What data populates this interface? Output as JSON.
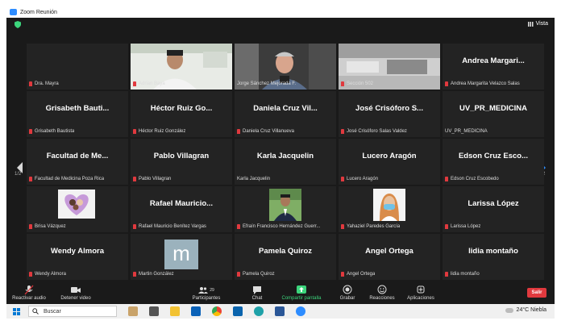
{
  "window": {
    "title": "Zoom Reunión"
  },
  "topbar": {
    "view_label": "Vista"
  },
  "pagination": {
    "left": "1/2",
    "right": "1/2"
  },
  "tiles": [
    {
      "big": "",
      "label": "Dra. Mayra",
      "muted": true,
      "video": "blank"
    },
    {
      "big": "",
      "label": "Adrian Baya",
      "muted": true,
      "video": "man-office"
    },
    {
      "big": "",
      "label": "Jorge Sánchez Mejorada F.",
      "muted": false,
      "video": "man-speaking",
      "active": true
    },
    {
      "big": "",
      "label": "Sección 502",
      "muted": true,
      "video": "classroom"
    },
    {
      "big": "Andrea Margari...",
      "label": "Andrea Margarita Velazco Salas",
      "muted": true
    },
    {
      "big": "Grisabeth Bauti...",
      "label": "Grisabeth Bautista",
      "muted": true
    },
    {
      "big": "Héctor Ruiz Go...",
      "label": "Héctor Ruiz González",
      "muted": true
    },
    {
      "big": "Daniela Cruz Vil...",
      "label": "Daniela Cruz Villanueva",
      "muted": true
    },
    {
      "big": "José Crisóforo S...",
      "label": "José Crisóforo Salas Valdez",
      "muted": true
    },
    {
      "big": "UV_PR_MEDICINA",
      "label": "UV_PR_MEDICINA",
      "muted": false
    },
    {
      "big": "Facultad de Me...",
      "label": "Facultad de Medicina Poza Rica",
      "muted": true
    },
    {
      "big": "Pablo Villagran",
      "label": "Pablo Villagran",
      "muted": true
    },
    {
      "big": "Karla Jacquelin",
      "label": "Karla Jacquelin",
      "muted": false
    },
    {
      "big": "Lucero Aragón",
      "label": "Lucero Aragón",
      "muted": true
    },
    {
      "big": "Edson Cruz Esco...",
      "label": "Edson Cruz Escobedo",
      "muted": true
    },
    {
      "big": "",
      "label": "Brisa Vázquez",
      "muted": true,
      "video": "heart"
    },
    {
      "big": "Rafael Mauricio...",
      "label": "Rafael Mauricio Benítez Vargas",
      "muted": true
    },
    {
      "big": "",
      "label": "Efraín Francisco Hernández Guerr...",
      "muted": true,
      "video": "man-suit"
    },
    {
      "big": "",
      "label": "Yahaziel Paredes García",
      "muted": true,
      "video": "woman-mask"
    },
    {
      "big": "Larissa López",
      "label": "Larissa López",
      "muted": true
    },
    {
      "big": "Wendy Almora",
      "label": "Wendy Almora",
      "muted": true
    },
    {
      "big": "",
      "label": "Martin González",
      "muted": true,
      "video": "initial",
      "initial": "m"
    },
    {
      "big": "Pamela Quiroz",
      "label": "Pamela Quiroz",
      "muted": true
    },
    {
      "big": "Angel Ortega",
      "label": "Angel Ortega",
      "muted": true
    },
    {
      "big": "lidia montaño",
      "label": "lidia montaño",
      "muted": true
    }
  ],
  "toolbar": {
    "audio": "Reactivar audio",
    "video": "Detener video",
    "participants": "Participantes",
    "participants_count": "29",
    "chat": "Chat",
    "share": "Compartir pantalla",
    "record": "Grabar",
    "reactions": "Reacciones",
    "apps": "Aplicaciones",
    "leave": "Salir"
  },
  "taskbar": {
    "search_placeholder": "Buscar",
    "temperature": "24°C",
    "weather": "Niebla"
  },
  "colors": {
    "active_speaker": "#b4e05a",
    "muted_red": "#e0393e",
    "share_green": "#3cd57c",
    "leave_red": "#e0393e"
  }
}
